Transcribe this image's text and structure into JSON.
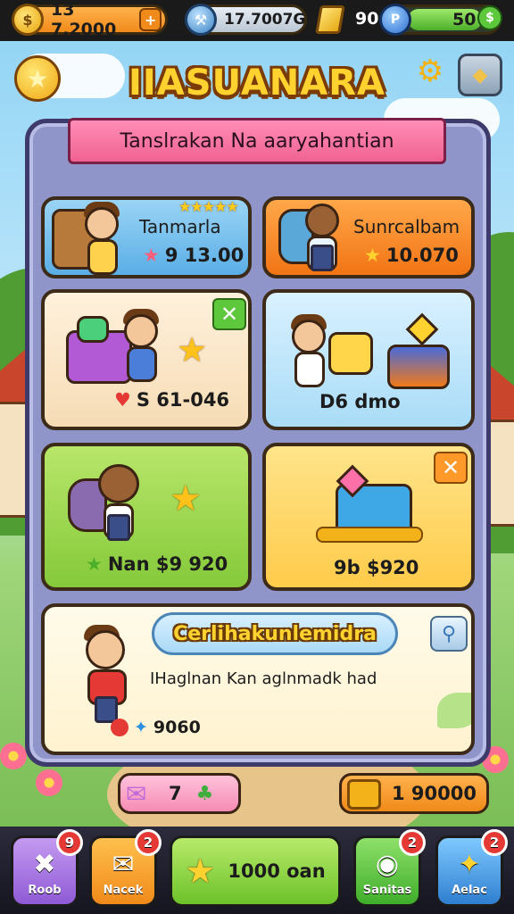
{
  "status_bar": {
    "coins_value": "13 7.2000",
    "storage_value": "17.7007GB",
    "level_value": "90",
    "energy_value": "50",
    "energy_fill": 0.85
  },
  "header": {
    "title": "IIASUANARA"
  },
  "panel": {
    "banner": "Tanslrakan Na aaryahantian",
    "cards": [
      {
        "name": "Tanmarla",
        "price": "9 13.00",
        "rating_stars": 5,
        "price_icon": "star"
      },
      {
        "name": "Sunrcalbam",
        "price": "10.070",
        "price_icon": "star"
      },
      {
        "price": "S 61-046",
        "price_icon": "heart",
        "has_close": true
      },
      {
        "price": "D6 dmo",
        "price_icon": "none"
      },
      {
        "price": "Nan $9 920",
        "price_icon": "star"
      },
      {
        "price": "9b $920",
        "price_icon": "none",
        "has_close": true
      }
    ],
    "feature": {
      "title": "Cerlihakunlemidra",
      "subtitle": "IHaglnan Kan aglnmadk had",
      "value": "9060"
    }
  },
  "bottom_strip": {
    "left_value": "7",
    "right_value": "1 90000"
  },
  "nav": [
    {
      "label": "Roob",
      "badge": "9",
      "icon": "scissors-icon"
    },
    {
      "label": "Nacek",
      "badge": "2",
      "icon": "mail-icon"
    },
    {
      "label": "1000 oan",
      "badge": "",
      "icon": "star-icon"
    },
    {
      "label": "Sanitas",
      "badge": "2",
      "icon": "pet-icon"
    },
    {
      "label": "Aelac",
      "badge": "2",
      "icon": "sparkle-icon"
    }
  ],
  "colors": {
    "panel_bg": "#8f95c8",
    "panel_border": "#3e3a6b",
    "card_blue": "#7ec3ee",
    "card_orange": "#ff8a1f",
    "card_cream": "#fbe7c8",
    "card_skyblue": "#bfe6fb",
    "card_green": "#9fd64a",
    "card_yellow": "#ffd566",
    "ribbon_pink": "#f06292",
    "title_gold": "#ffd230"
  }
}
